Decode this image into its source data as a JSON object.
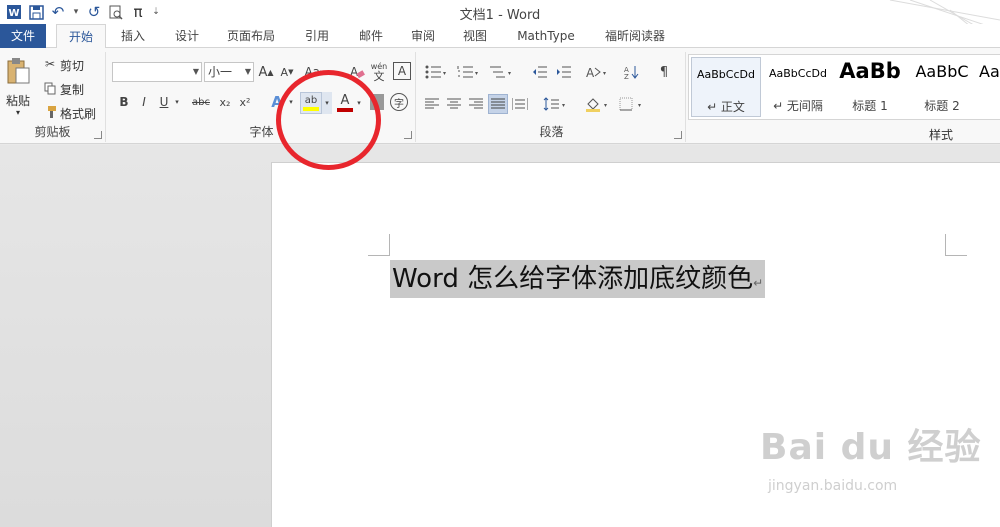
{
  "window": {
    "title": "文档1 - Word"
  },
  "quick_access": {
    "pi_symbol": "π"
  },
  "tabs": [
    {
      "label": "文件"
    },
    {
      "label": "开始"
    },
    {
      "label": "插入"
    },
    {
      "label": "设计"
    },
    {
      "label": "页面布局"
    },
    {
      "label": "引用"
    },
    {
      "label": "邮件"
    },
    {
      "label": "审阅"
    },
    {
      "label": "视图"
    },
    {
      "label": "MathType"
    },
    {
      "label": "福昕阅读器"
    }
  ],
  "clipboard": {
    "label": "剪贴板",
    "paste": "粘贴",
    "cut": "剪切",
    "copy": "复制",
    "format_painter": "格式刷"
  },
  "font": {
    "label": "字体",
    "font_name": "",
    "font_size": "小一",
    "bold": "B",
    "italic": "I",
    "underline": "U",
    "strikethrough": "abc",
    "subscript": "x₂",
    "superscript": "x²",
    "grow": "A",
    "shrink": "A",
    "case": "Aa",
    "phonetic_top": "wén",
    "phonetic_bottom": "文",
    "border_char": "A",
    "highlight": "ab",
    "font_color": "A",
    "enclose": "字",
    "text_effect": "A",
    "highlight_color": "#ffff00",
    "font_color_value": "#c00000"
  },
  "paragraph": {
    "label": "段落"
  },
  "styles": {
    "label": "样式",
    "items": [
      {
        "sample": "AaBbCcDd",
        "name": "↵ 正文"
      },
      {
        "sample": "AaBbCcDd",
        "name": "↵ 无间隔"
      },
      {
        "sample": "AaBb",
        "name": "标题 1"
      },
      {
        "sample": "AaBbC",
        "name": "标题 2"
      },
      {
        "sample": "Aa",
        "name": ""
      }
    ]
  },
  "document": {
    "text": "Word 怎么给字体添加底纹颜色",
    "para_mark": "↵"
  },
  "watermark": {
    "main": "Bai du 经验",
    "sub": "jingyan.baidu.com"
  },
  "colors": {
    "accent": "#2b579a",
    "annotation_circle": "#e8262d",
    "selection": "#c9c9c9"
  }
}
